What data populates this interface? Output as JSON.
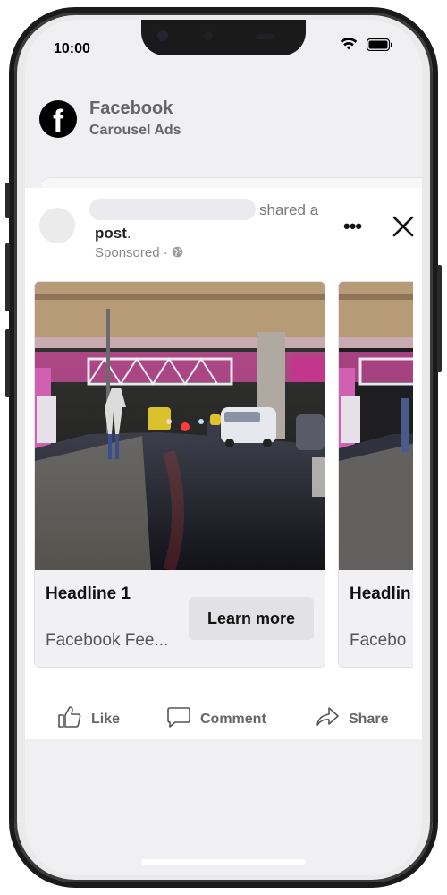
{
  "status_bar": {
    "time": "10:00"
  },
  "header": {
    "logo_glyph": "f",
    "title": "Facebook",
    "subtitle": "Carousel Ads"
  },
  "post": {
    "shared_text": "shared a",
    "post_word": "post",
    "post_punct": ".",
    "sponsored": "Sponsored ·",
    "more_label": "•••",
    "cards": [
      {
        "headline": "Headline 1",
        "description": "Facebook Fee...",
        "cta": "Learn more"
      },
      {
        "headline": "Headlin",
        "description": "Facebo"
      }
    ]
  },
  "actions": {
    "like": "Like",
    "comment": "Comment",
    "share": "Share"
  },
  "colors": {
    "frame": "#1a1a1a",
    "screen_bg": "#f0f0f2",
    "button_bg": "#e2e2e6",
    "text_muted": "#666666"
  }
}
